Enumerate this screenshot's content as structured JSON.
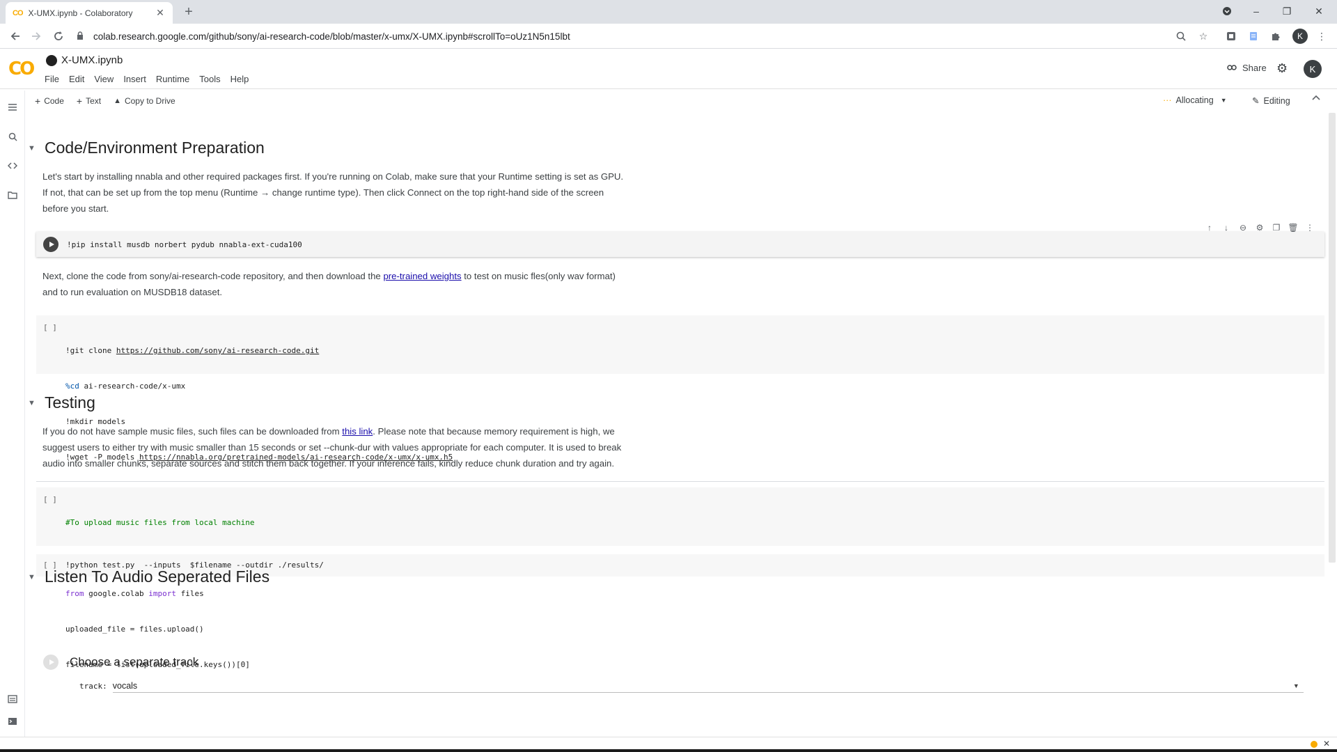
{
  "browser": {
    "tab_title": "X-UMX.ipynb - Colaboratory",
    "favicon_text": "CO",
    "tab_close": "✕",
    "new_tab": "+",
    "url": "colab.research.google.com/github/sony/ai-research-code/blob/master/x-umx/X-UMX.ipynb#scrollTo=oUz1N5n15lbt",
    "profile_initial": "K",
    "window_controls": {
      "minimize": "–",
      "maximize": "❐",
      "close": "✕"
    }
  },
  "colab": {
    "logo": "CO",
    "notebook_name": "X-UMX.ipynb",
    "menu": [
      "File",
      "Edit",
      "View",
      "Insert",
      "Runtime",
      "Tools",
      "Help"
    ],
    "share_label": "Share",
    "avatar_initial": "K"
  },
  "toolbar": {
    "code_label": "Code",
    "text_label": "Text",
    "copy_label": "Copy to Drive",
    "runtime_status": "Allocating",
    "editing_label": "Editing"
  },
  "sections": {
    "prep": {
      "title": "Code/Environment Preparation",
      "para_lines": [
        "Let's start by installing nnabla and other required packages first. If you're running on Colab, make sure that your Runtime setting is set as GPU.",
        "If not, that can be set up from the top menu (Runtime → change runtime type). Then click Connect on the top right-hand side of the screen",
        "before you start."
      ],
      "pip_cell": "!pip install musdb norbert pydub nnabla-ext-cuda100",
      "clone_para": {
        "before_link": "Next, clone the code from sony/ai-research-code repository, and then download the ",
        "link": "pre-trained weights",
        "after_link": " to test on music fles(only wav format)",
        "line2": "and to run evaluation on MUSDB18 dataset."
      },
      "clone_cell": {
        "bracket": "[ ]",
        "l1_cmd": "!git clone ",
        "l1_url": "https://github.com/sony/ai-research-code.git",
        "l2_magic": "%cd",
        "l2_rest": " ai-research-code/x-umx",
        "l3": "!mkdir models",
        "l4_cmd": "!wget -P models ",
        "l4_url": "https://nnabla.org/pretrained-models/ai-research-code/x-umx/x-umx.h5"
      }
    },
    "testing": {
      "title": "Testing",
      "p1_before": "If you do not have sample music files, such files can be downloaded from ",
      "p1_link": "this link",
      "p1_after": ". Please note that because memory requirement is high, we",
      "p2": "suggest users to either try with music smaller than 15 seconds or set --chunk-dur with values appropriate for each computer. It is used to break",
      "p3": "audio into smaller chunks, separate sources and stitch them back together. If your inference fails, kindly reduce chunk duration and try again.",
      "upload_cell": {
        "bracket": "[ ]",
        "comment": "#To upload music files from local machine",
        "l2_from": "from",
        "l2_mid": " google.colab ",
        "l2_import": "import",
        "l2_end": " files",
        "l3": "uploaded_file = files.upload()",
        "l4": "filename = list(uploaded_file.keys())[0]"
      },
      "run_cell": {
        "bracket": "[ ]",
        "code": "!python test.py  --inputs  $filename --outdir ./results/"
      }
    },
    "listen": {
      "title": "Listen To Audio Seperated Files",
      "form_title": "Choose a separate track",
      "field_label": "track:",
      "field_value": "vocals"
    }
  },
  "colors": {
    "colab_orange": "#f9ab00",
    "link": "#1a0dab",
    "keyword": "#7b30d0",
    "comment": "#008000"
  },
  "icons": {
    "back": "back-arrow-icon",
    "forward": "forward-arrow-icon",
    "reload": "reload-icon",
    "cell_toolbar": [
      "move-up-icon",
      "move-down-icon",
      "link-icon",
      "settings-icon",
      "mirror-icon",
      "delete-icon",
      "more-icon"
    ]
  }
}
